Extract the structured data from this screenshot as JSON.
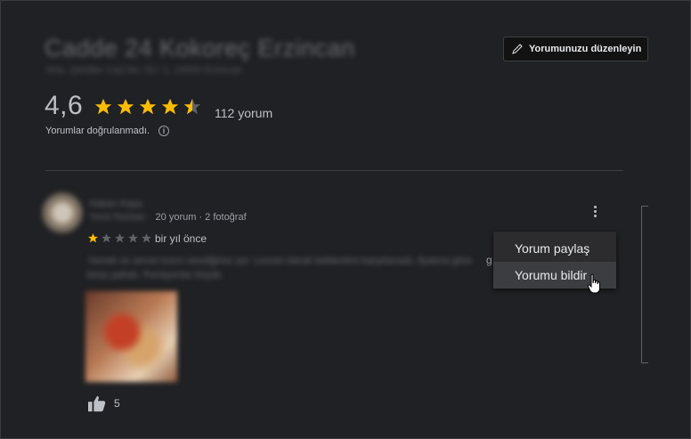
{
  "place": {
    "title": "Cadde 24 Kokoreç Erzincan",
    "subtitle": "Ahis, Şehitler Cad.No: 53 / 1, 24000 Erzincan"
  },
  "edit_button": {
    "label": "Yorumunuzu düzenleyin",
    "icon": "pencil-icon"
  },
  "rating": {
    "value": "4,6",
    "stars": 4.6,
    "count_label": "112 yorum",
    "unverified_label": "Yorumlar doğrulanmadı.",
    "info_icon": "info-icon"
  },
  "review": {
    "author": "Hakan Kaya",
    "local_guide": "Yerel Rehber ·",
    "meta": "20 yorum · 2 fotoğraf",
    "stars": 1,
    "date": "bir yıl önce",
    "text": "Yemek ve servis kısmı sevdiğimiz yer. Lezzet olarak beklentimi karşılamadı, fiyatına göre biraz pahalı. Porsiyonlar küçük.",
    "text_tail": "g",
    "likes": "5",
    "like_icon": "thumbs-up-icon",
    "more_icon": "more-vert-icon"
  },
  "menu": {
    "items": [
      {
        "label": "Yorum paylaş"
      },
      {
        "label": "Yorumu bildir"
      }
    ]
  },
  "colors": {
    "background": "#202124",
    "star": "#fbbc04",
    "text": "#bdc1c6"
  }
}
